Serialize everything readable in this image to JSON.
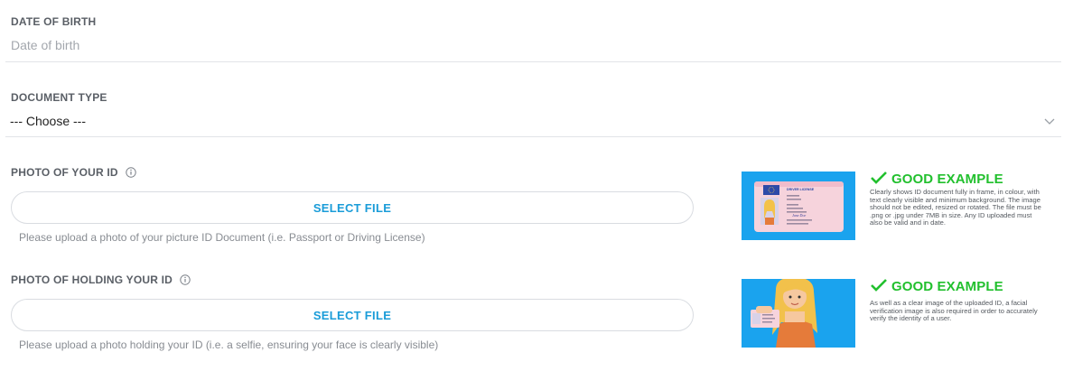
{
  "dob": {
    "label": "DATE OF BIRTH",
    "placeholder": "Date of birth"
  },
  "document_type": {
    "label": "DOCUMENT TYPE",
    "selected": "--- Choose ---"
  },
  "photo_id": {
    "label": "PHOTO OF YOUR ID",
    "button": "SELECT FILE",
    "help": "Please upload a photo of your picture ID Document (i.e. Passport or Driving License)",
    "example_heading": "GOOD EXAMPLE",
    "example_text": "Clearly shows ID document fully in frame, in colour, with text clearly visible and minimum background. The image should not be edited, resized or rotated. The file must be .png or .jpg under 7MB in size. Any ID uploaded must also be valid and in date.",
    "card_title": "DRIVER LICENSE",
    "card_signature": "Jane Doe"
  },
  "photo_holding": {
    "label": "PHOTO OF HOLDING YOUR ID",
    "button": "SELECT FILE",
    "help": "Please upload a photo holding your ID (i.e. a selfie, ensuring your face is clearly visible)",
    "example_heading": "GOOD EXAMPLE",
    "example_text": "As well as a clear image of the uploaded ID, a facial verification image is also required in order to accurately verify the identity of a user."
  },
  "colors": {
    "accent": "#1a9cd8",
    "good": "#22c02e",
    "example_bg": "#1aa3ee"
  },
  "icons": [
    "info-icon",
    "chevron-down-icon",
    "check-icon"
  ]
}
